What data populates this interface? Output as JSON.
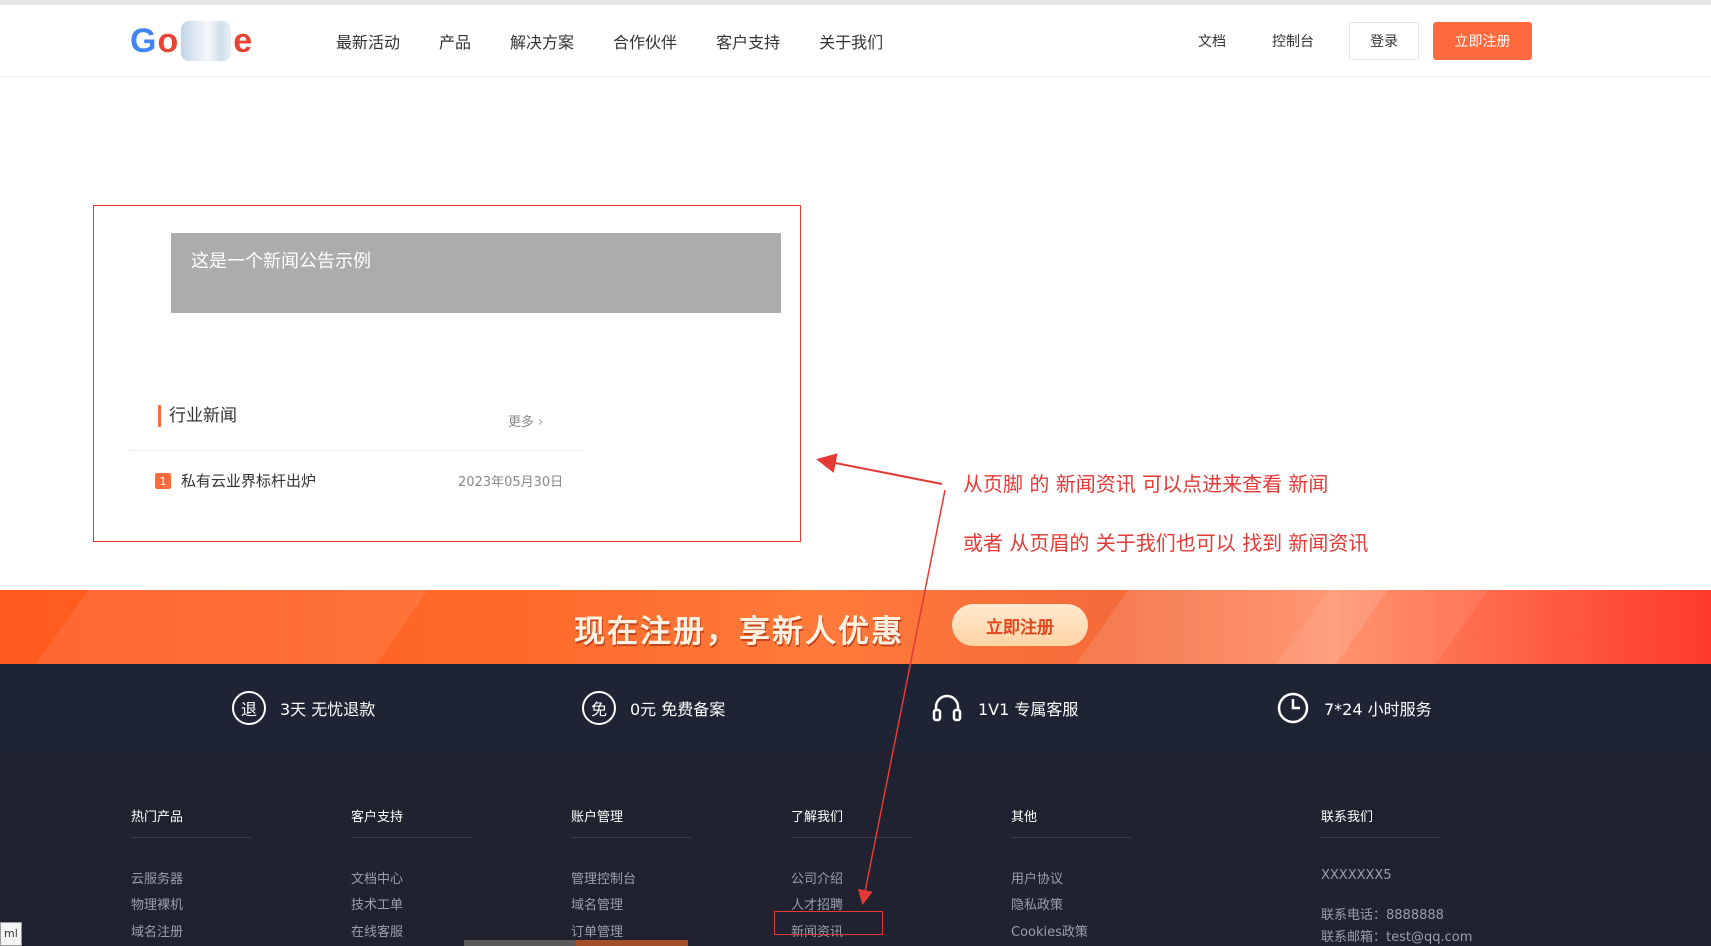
{
  "header": {
    "logo_text": "Google",
    "nav": [
      "最新活动",
      "产品",
      "解决方案",
      "合作伙伴",
      "客户支持",
      "关于我们"
    ],
    "right_links": [
      "文档",
      "控制台"
    ],
    "login_label": "登录",
    "register_label": "立即注册"
  },
  "notice": {
    "text": "这是一个新闻公告示例"
  },
  "news": {
    "section_title": "行业新闻",
    "more_label": "更多",
    "items": [
      {
        "num": "1",
        "title": "私有云业界标杆出炉",
        "date": "2023年05月30日"
      }
    ]
  },
  "annotations": {
    "note1": "从页脚 的 新闻资讯 可以点进来查看 新闻",
    "note2": "或者 从页眉的 关于我们也可以 找到 新闻资讯",
    "color": "#e53935"
  },
  "banner": {
    "text": "现在注册，享新人优惠",
    "button_label": "立即注册"
  },
  "features": [
    {
      "icon": "退",
      "label": "3天 无忧退款"
    },
    {
      "icon": "免",
      "label": "0元 免费备案"
    },
    {
      "icon": "headset-icon",
      "label": "1V1 专属客服"
    },
    {
      "icon": "clock-icon",
      "label": "7*24 小时服务"
    }
  ],
  "footer": {
    "columns": [
      {
        "title": "热门产品",
        "links": [
          "云服务器",
          "物理裸机",
          "域名注册"
        ]
      },
      {
        "title": "客户支持",
        "links": [
          "文档中心",
          "技术工单",
          "在线客服"
        ]
      },
      {
        "title": "账户管理",
        "links": [
          "管理控制台",
          "域名管理",
          "订单管理"
        ]
      },
      {
        "title": "了解我们",
        "links": [
          "公司介绍",
          "人才招聘",
          "新闻资讯"
        ]
      },
      {
        "title": "其他",
        "links": [
          "用户协议",
          "隐私政策",
          "Cookies政策"
        ]
      },
      {
        "title": "联系我们",
        "links": [
          "XXXXXXX5",
          "联系电话：8888888",
          "联系邮箱：test@qq.com"
        ]
      }
    ]
  },
  "bottom_tab": "ml",
  "colors": {
    "accent": "#ff6a3d",
    "footer_bg": "#20232f",
    "features_bg": "#1f2434"
  }
}
